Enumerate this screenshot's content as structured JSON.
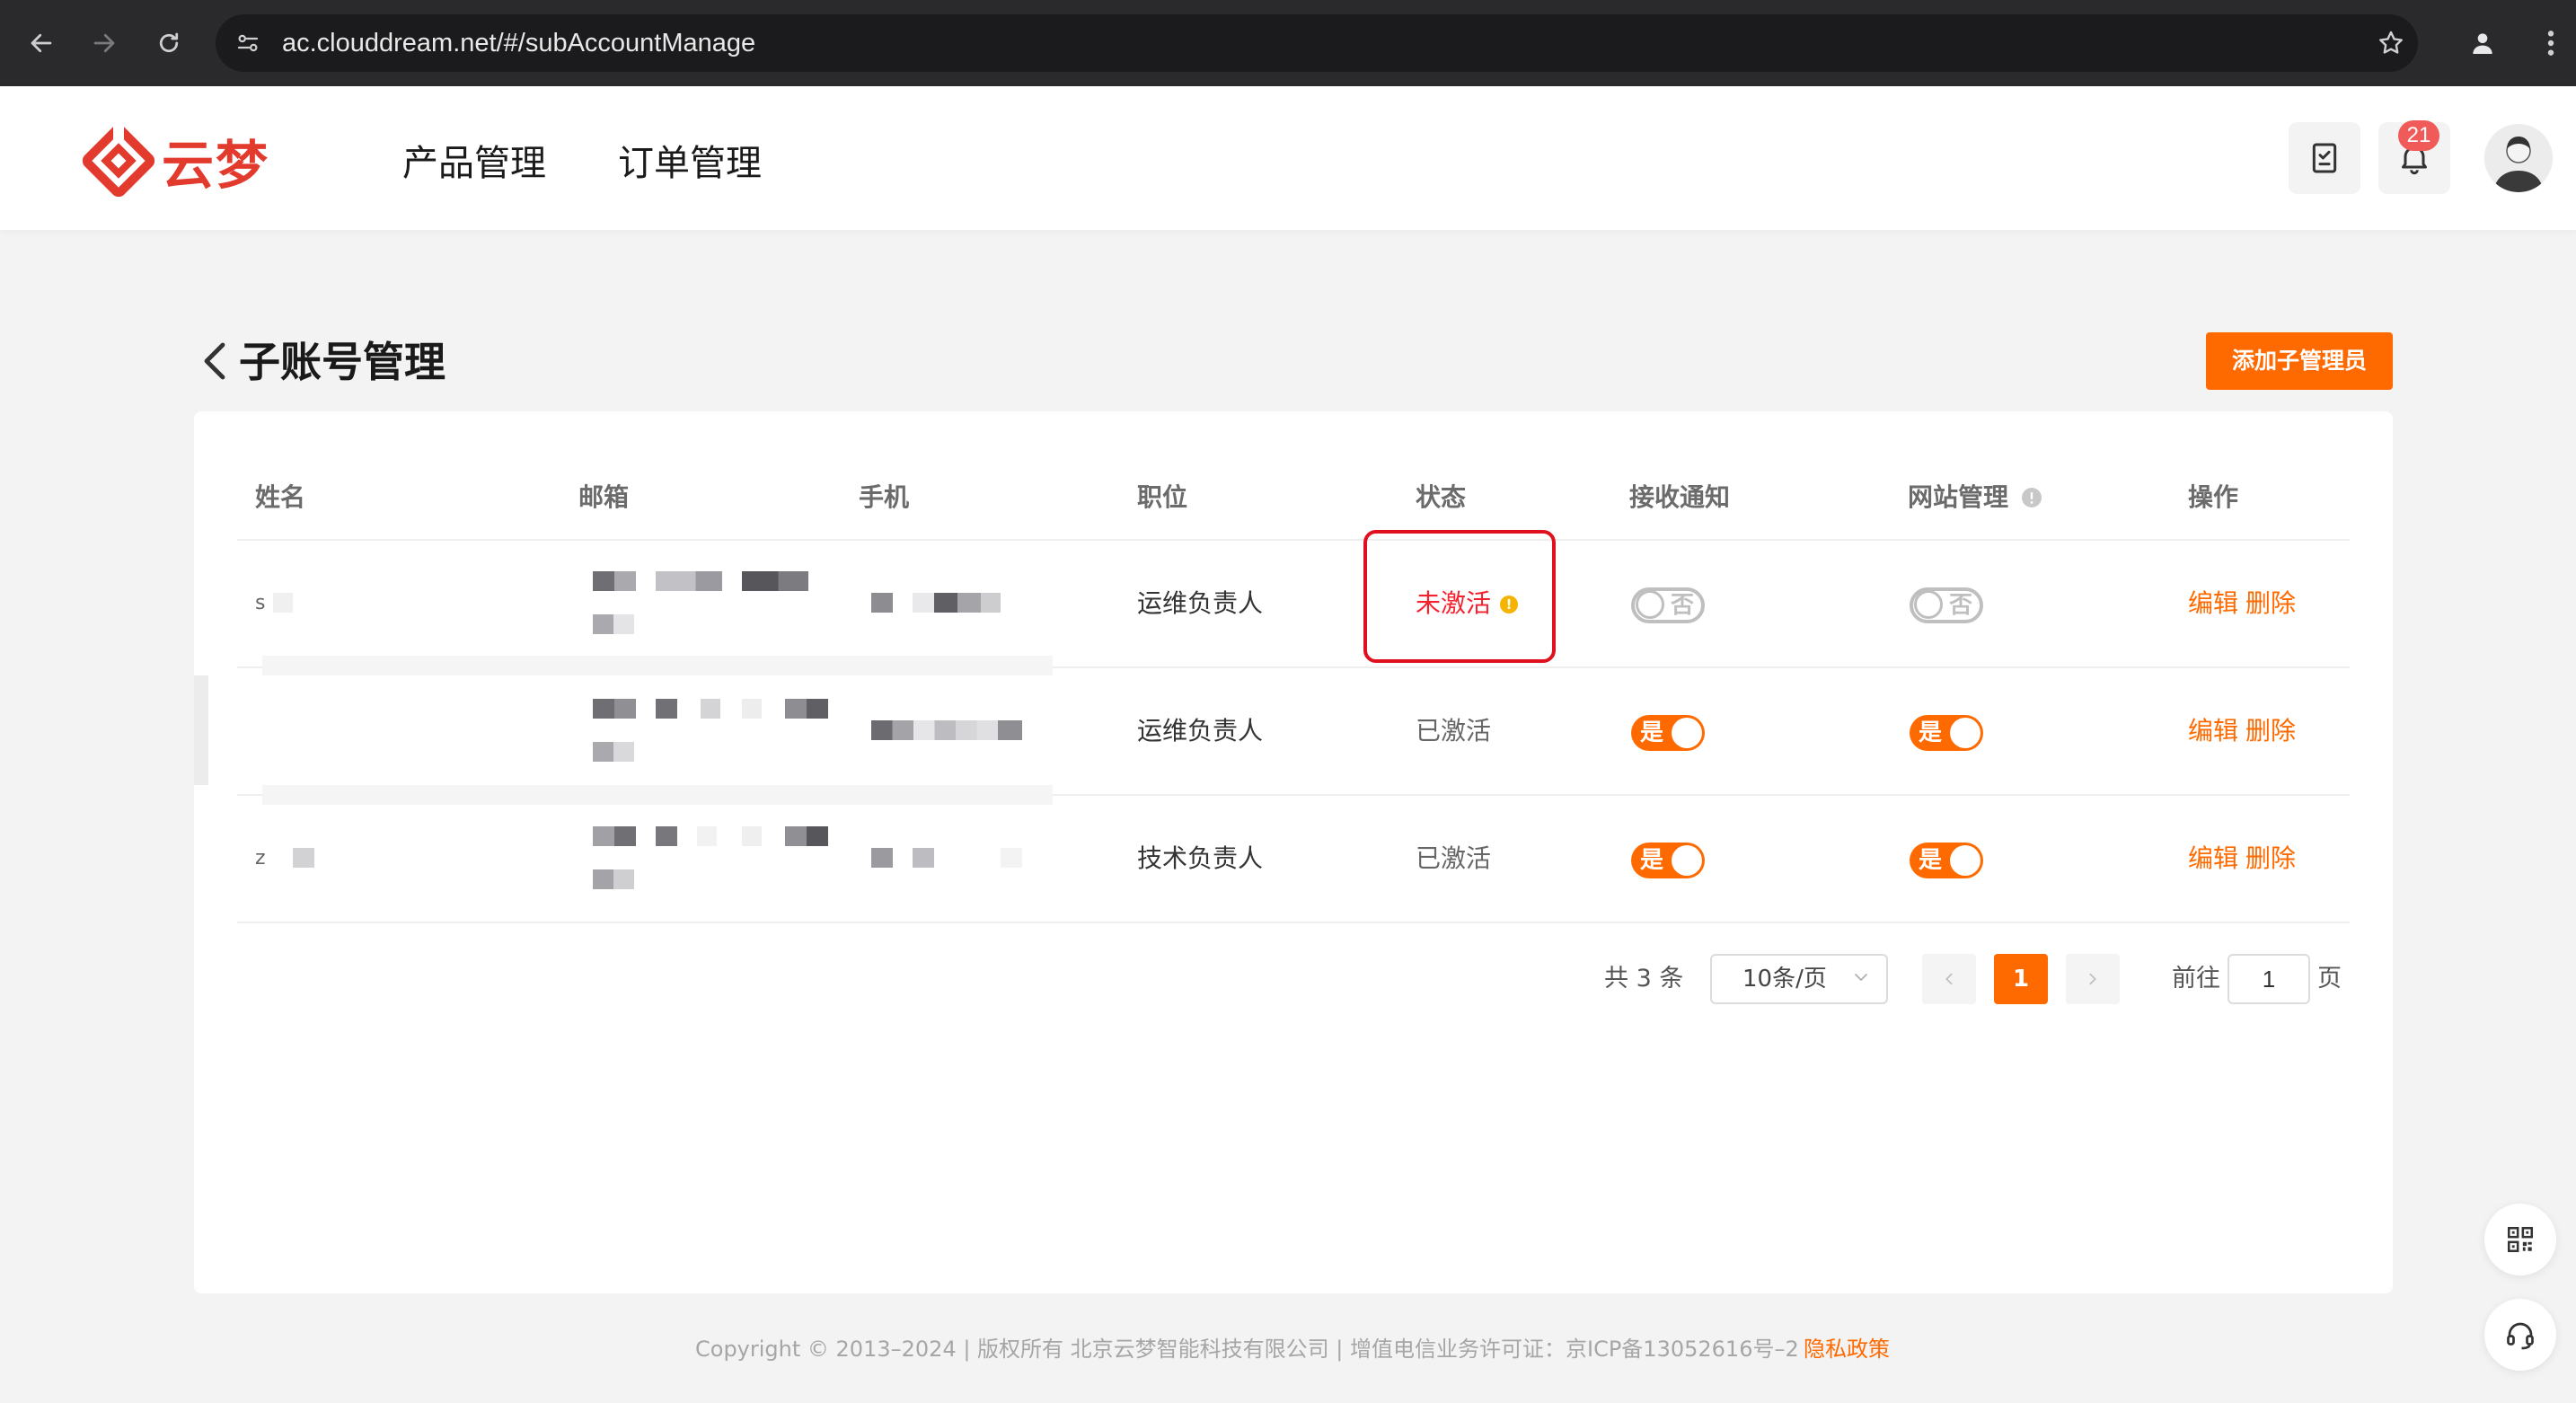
{
  "browser": {
    "url": "ac.clouddream.net/#/subAccountManage"
  },
  "header": {
    "logo_text": "云梦",
    "nav": [
      "产品管理",
      "订单管理"
    ],
    "notification_count": "21"
  },
  "page": {
    "title": "子账号管理",
    "add_button": "添加子管理员"
  },
  "table": {
    "columns": [
      "姓名",
      "邮箱",
      "手机",
      "职位",
      "状态",
      "接收通知",
      "网站管理",
      "操作"
    ],
    "rows": [
      {
        "name_initial": "s",
        "position": "运维负责人",
        "status": "未激活",
        "status_active": false,
        "notify": "否",
        "notify_on": false,
        "site_manage": "否",
        "site_on": false
      },
      {
        "name_initial": "",
        "position": "运维负责人",
        "status": "已激活",
        "status_active": true,
        "notify": "是",
        "notify_on": true,
        "site_manage": "是",
        "site_on": true
      },
      {
        "name_initial": "z",
        "position": "技术负责人",
        "status": "已激活",
        "status_active": true,
        "notify": "是",
        "notify_on": true,
        "site_manage": "是",
        "site_on": true
      }
    ],
    "actions": {
      "edit": "编辑",
      "delete": "删除"
    }
  },
  "pagination": {
    "total_text": "共 3 条",
    "page_size": "10条/页",
    "current_page": "1",
    "goto_prefix": "前往",
    "goto_value": "1",
    "goto_suffix": "页"
  },
  "footer": {
    "copyright": "Copyright © 2013–2024 | 版权所有 北京云梦智能科技有限公司 | 增值电信业务许可证：京ICP备13052616号–2",
    "privacy": "隐私政策"
  },
  "colors": {
    "accent": "#ff6a00",
    "brand_red": "#e33a2e",
    "status_inactive": "#f5222d"
  },
  "icons": [
    "back-arrow-icon",
    "forward-arrow-icon",
    "reload-icon",
    "site-settings-icon",
    "star-icon",
    "profile-icon",
    "more-vertical-icon",
    "clipboard-check-icon",
    "bell-icon",
    "chevron-left-icon",
    "info-icon",
    "warning-icon",
    "chevron-down-icon",
    "chevron-right-icon",
    "qr-code-icon",
    "headset-icon"
  ]
}
